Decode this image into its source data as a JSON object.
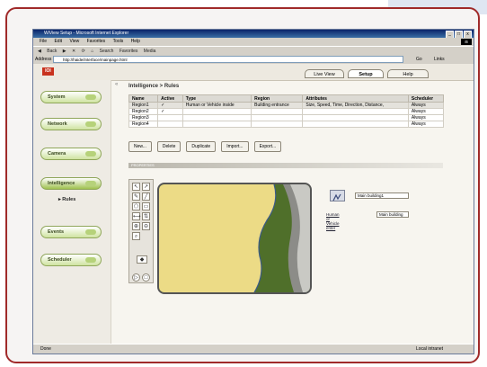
{
  "window": {
    "title": "WiView Setup - Microsoft Internet Explorer",
    "controls": [
      "_",
      "□",
      "x"
    ]
  },
  "menu": [
    "File",
    "Edit",
    "View",
    "Favorites",
    "Tools",
    "Help"
  ],
  "ie_toolbar": [
    "Back",
    "Search",
    "Favorites",
    "Media"
  ],
  "address": {
    "label": "Address",
    "url": "http://haide/interface/mainpage.html",
    "go": "Go",
    "links": "Links"
  },
  "app": {
    "brand": "IOI",
    "tabs": [
      "Live View",
      "Setup",
      "Help"
    ]
  },
  "sidebar": {
    "items": [
      "System",
      "Network",
      "Camera",
      "Intelligence",
      "Events",
      "Scheduler"
    ],
    "active": "Intelligence",
    "subitem": "Rules"
  },
  "breadcrumb": "Intelligence > Rules",
  "rules_table": {
    "columns": [
      "Name",
      "Active",
      "Type",
      "Region",
      "Attributes",
      "Scheduler"
    ],
    "rows": [
      [
        "Region1",
        "✓",
        "Human or Vehicle inside",
        "Building entrance",
        "Size, Speed, Time, Direction, Distance,",
        "Always"
      ],
      [
        "Region2",
        "✓",
        "",
        "",
        "",
        "Always"
      ],
      [
        "Region3",
        "",
        "",
        "",
        "",
        "Always"
      ],
      [
        "Region4",
        "",
        "",
        "",
        "",
        "Always"
      ]
    ]
  },
  "actions": [
    "New...",
    "Delete",
    "Duplicate",
    "Import...",
    "Export..."
  ],
  "properties": {
    "header": "PROPERTIES",
    "name_value": "Main building1",
    "link_label": "Human or Vehicle enter",
    "link_value": "Main building"
  },
  "status": {
    "left": "Done",
    "zone": "Local intranet"
  }
}
